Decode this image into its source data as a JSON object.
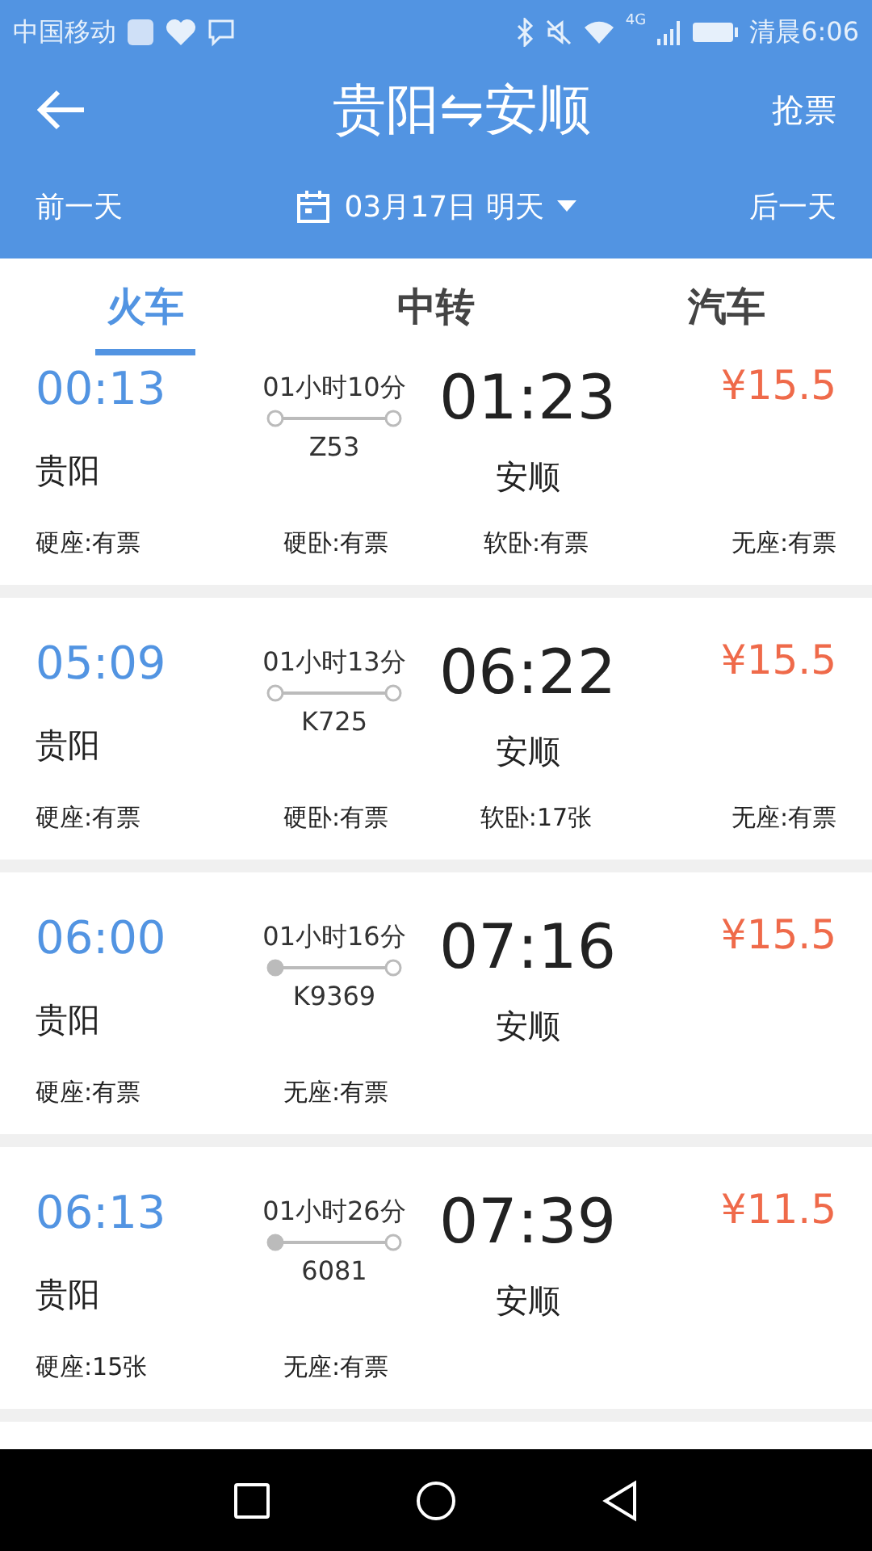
{
  "status_bar": {
    "carrier": "中国移动",
    "network": "4G",
    "time": "清晨6:06"
  },
  "header": {
    "title": "贵阳⇋安顺",
    "action": "抢票",
    "prev_day": "前一天",
    "date": "03月17日 明天",
    "next_day": "后一天"
  },
  "tabs": [
    {
      "label": "火车",
      "selected": true
    },
    {
      "label": "中转",
      "selected": false
    },
    {
      "label": "汽车",
      "selected": false
    }
  ],
  "trains": [
    {
      "depart_time": "00:13",
      "depart_station": "贵阳",
      "duration": "01小时10分",
      "number": "Z53",
      "origin_start": false,
      "arrive_time": "01:23",
      "arrive_station": "安顺",
      "price": "¥15.5",
      "seats": [
        "硬座:有票",
        "硬卧:有票",
        "软卧:有票",
        "无座:有票"
      ]
    },
    {
      "depart_time": "05:09",
      "depart_station": "贵阳",
      "duration": "01小时13分",
      "number": "K725",
      "origin_start": false,
      "arrive_time": "06:22",
      "arrive_station": "安顺",
      "price": "¥15.5",
      "seats": [
        "硬座:有票",
        "硬卧:有票",
        "软卧:17张",
        "无座:有票"
      ]
    },
    {
      "depart_time": "06:00",
      "depart_station": "贵阳",
      "duration": "01小时16分",
      "number": "K9369",
      "origin_start": true,
      "arrive_time": "07:16",
      "arrive_station": "安顺",
      "price": "¥15.5",
      "seats": [
        "硬座:有票",
        "无座:有票"
      ]
    },
    {
      "depart_time": "06:13",
      "depart_station": "贵阳",
      "duration": "01小时26分",
      "number": "6081",
      "origin_start": true,
      "arrive_time": "07:39",
      "arrive_station": "安顺",
      "price": "¥11.5",
      "seats": [
        "硬座:15张",
        "无座:有票"
      ]
    }
  ]
}
